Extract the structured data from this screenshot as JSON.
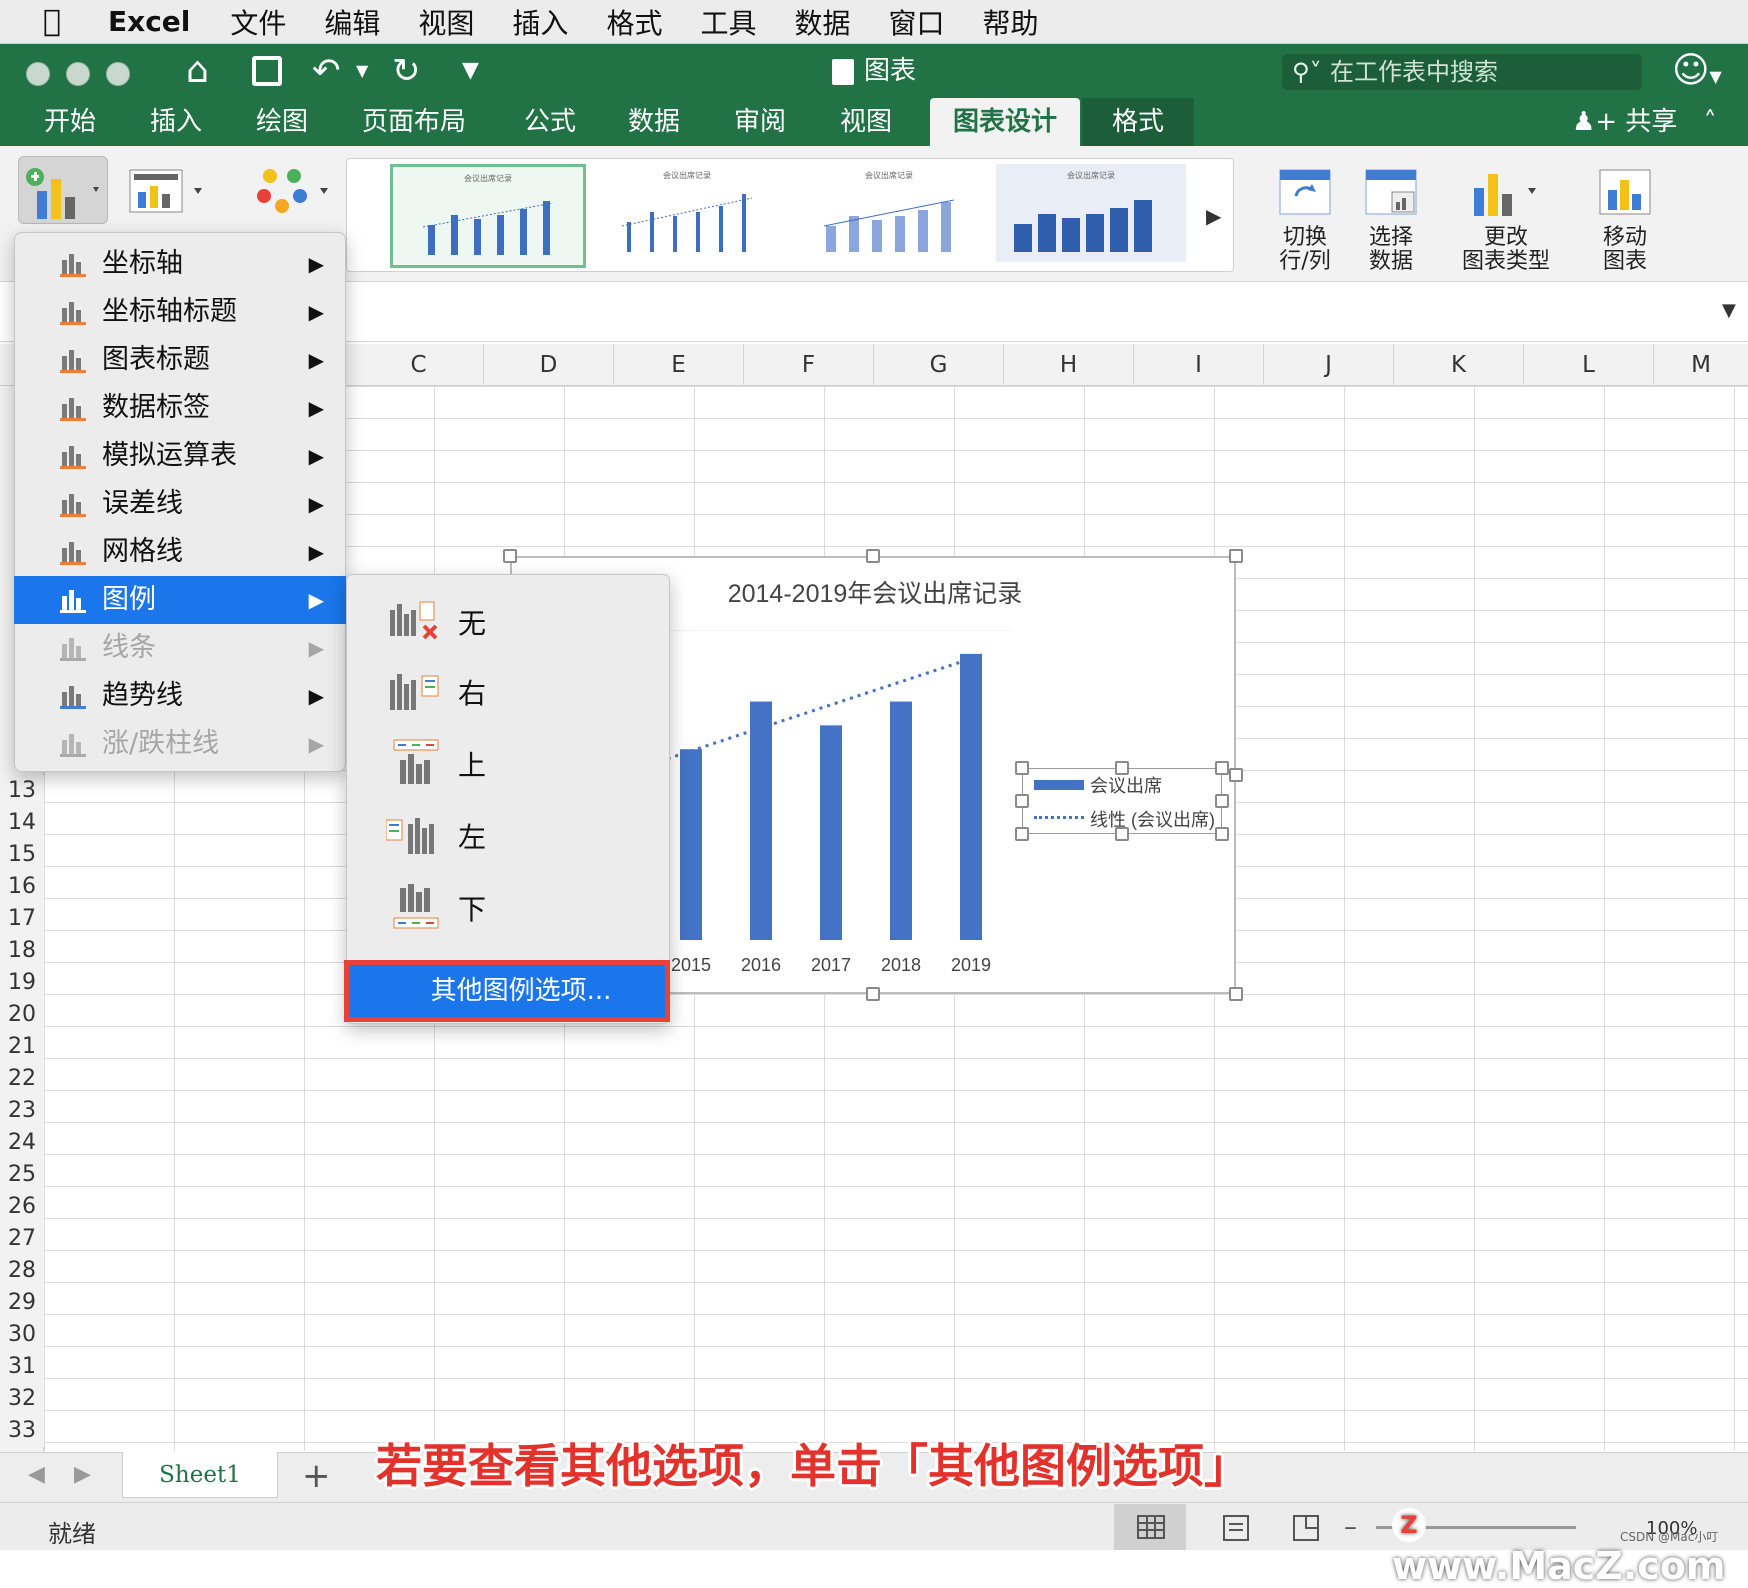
{
  "menubar": {
    "app": "Excel",
    "items": [
      "文件",
      "编辑",
      "视图",
      "插入",
      "格式",
      "工具",
      "数据",
      "窗口",
      "帮助"
    ]
  },
  "window": {
    "title": "图表",
    "search_placeholder": "在工作表中搜索"
  },
  "ribbon": {
    "tabs": [
      "开始",
      "插入",
      "绘图",
      "页面布局",
      "公式",
      "数据",
      "审阅",
      "视图",
      "图表设计",
      "格式"
    ],
    "active_tab": "图表设计",
    "share": "共享",
    "buttons": {
      "switch_row_col": "切换\n行/列",
      "select_data": "选择\n数据",
      "change_type": "更改\n图表类型",
      "move_chart": "移动\n图表"
    },
    "thumb_title": "会议出席记录"
  },
  "grid": {
    "columns": [
      "C",
      "D",
      "E",
      "F",
      "G",
      "H",
      "I",
      "J",
      "K",
      "L",
      "M"
    ],
    "rows": [
      "13",
      "14",
      "15",
      "16",
      "17",
      "18",
      "19",
      "20",
      "21",
      "22",
      "23",
      "24",
      "25",
      "26",
      "27",
      "28",
      "29",
      "30",
      "31",
      "32",
      "33"
    ]
  },
  "dropdown": {
    "items": [
      {
        "label": "坐标轴",
        "state": "normal"
      },
      {
        "label": "坐标轴标题",
        "state": "normal"
      },
      {
        "label": "图表标题",
        "state": "normal"
      },
      {
        "label": "数据标签",
        "state": "normal"
      },
      {
        "label": "模拟运算表",
        "state": "normal"
      },
      {
        "label": "误差线",
        "state": "normal"
      },
      {
        "label": "网格线",
        "state": "normal"
      },
      {
        "label": "图例",
        "state": "highlighted"
      },
      {
        "label": "线条",
        "state": "disabled"
      },
      {
        "label": "趋势线",
        "state": "normal"
      },
      {
        "label": "涨/跌柱线",
        "state": "disabled"
      }
    ]
  },
  "submenu": {
    "items": [
      "无",
      "右",
      "上",
      "左",
      "下"
    ],
    "more": "其他图例选项..."
  },
  "chart_data": {
    "type": "bar",
    "title": "2014-2019年会议出席记录",
    "categories": [
      "2015",
      "2016",
      "2017",
      "2018",
      "2019"
    ],
    "series": [
      {
        "name": "会议出席",
        "values": [
          800,
          1000,
          900,
          1000,
          1200
        ]
      }
    ],
    "trendline": {
      "name": "线性 (会议出席)",
      "style": "dotted",
      "start": 750,
      "end": 1180
    },
    "legend_position": "right",
    "colors": {
      "bar": "#4472c4",
      "trend": "#4472c4"
    }
  },
  "sheets": {
    "tabs": [
      "Sheet1"
    ],
    "add": "+"
  },
  "status": {
    "text": "就绪",
    "zoom": "100%"
  },
  "caption": "若要查看其他选项，单击「其他图例选项」",
  "watermark": "www.MacZ.com",
  "credit": "CSDN @Mac小叮"
}
